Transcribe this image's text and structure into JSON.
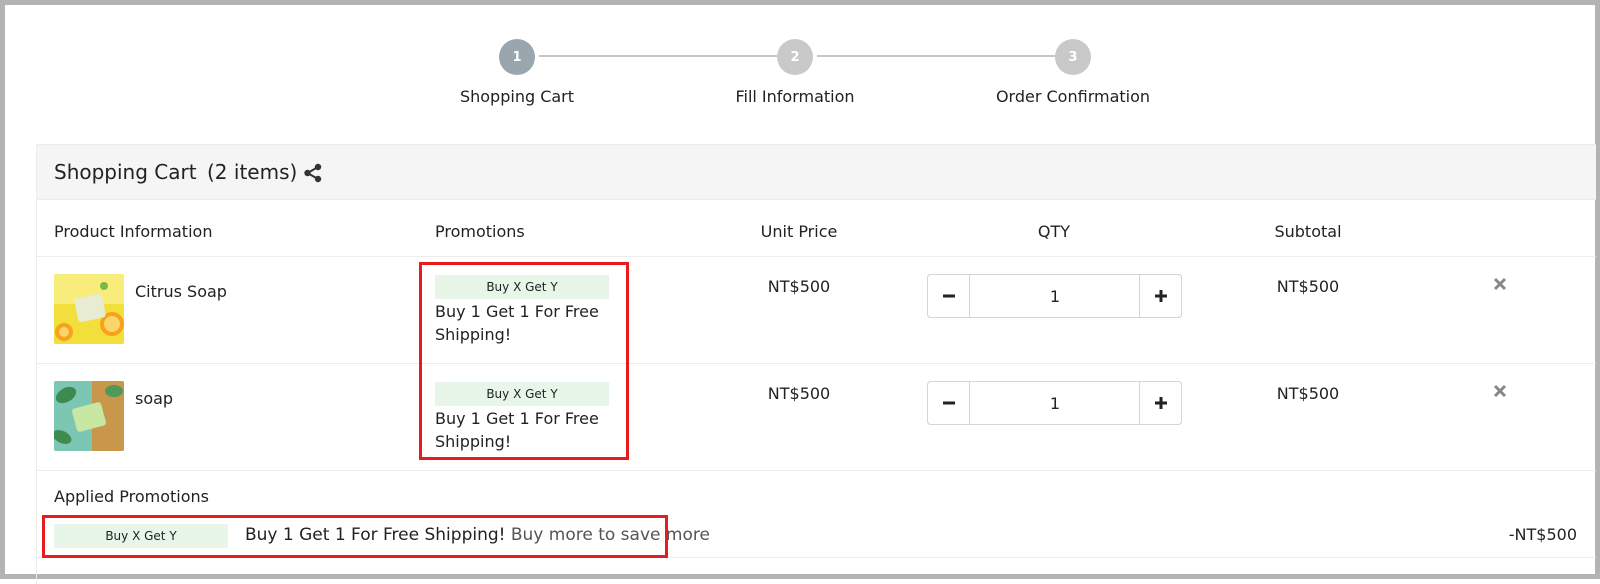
{
  "stepper": {
    "steps": [
      {
        "number": "1",
        "label": "Shopping Cart",
        "active": true
      },
      {
        "number": "2",
        "label": "Fill Information",
        "active": false
      },
      {
        "number": "3",
        "label": "Order Confirmation",
        "active": false
      }
    ]
  },
  "cart": {
    "title": "Shopping Cart",
    "count": "(2 items)",
    "share_icon": "share-icon",
    "columns": {
      "product": "Product Information",
      "promotions": "Promotions",
      "unit_price": "Unit Price",
      "qty": "QTY",
      "subtotal": "Subtotal"
    },
    "items": [
      {
        "name": "Citrus Soap",
        "image": "citrus-soap-photo",
        "promo_tag": "Buy X Get Y",
        "promo_desc": "Buy 1 Get 1 For Free Shipping!",
        "unit_price": "NT$500",
        "qty": "1",
        "subtotal": "NT$500"
      },
      {
        "name": "soap",
        "image": "green-soap-photo",
        "promo_tag": "Buy X Get Y",
        "promo_desc": "Buy 1 Get 1 For Free Shipping!",
        "unit_price": "NT$500",
        "qty": "1",
        "subtotal": "NT$500"
      }
    ],
    "applied": {
      "label": "Applied Promotions",
      "tag": "Buy X Get Y",
      "desc": "Buy 1 Get 1 For Free Shipping!",
      "more": "Buy more to save more",
      "discount": "-NT$500"
    }
  },
  "colors": {
    "step_active": "#9aa6ad",
    "step_inactive": "#c9c9c9",
    "promo_tag_bg": "#e7f6e9",
    "highlight": "#e81c1c"
  }
}
